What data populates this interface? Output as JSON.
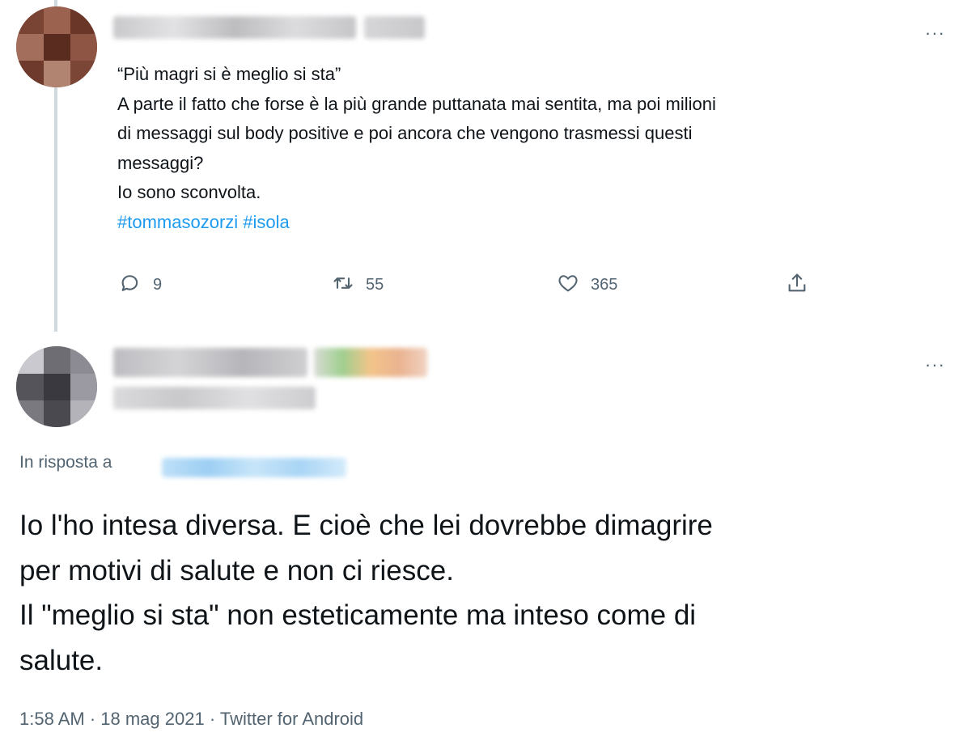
{
  "tweet1": {
    "more_label": "···",
    "lines": [
      "“Più magri si è meglio si sta”",
      "A parte il fatto che forse è la più grande puttanata mai sentita, ma poi milioni",
      "di messaggi sul body positive e poi ancora che vengono trasmessi questi",
      "messaggi?",
      "Io sono sconvolta."
    ],
    "hashtags": [
      "#tommasozorzi",
      "#isola"
    ],
    "stats": {
      "replies": "9",
      "retweets": "55",
      "likes": "365"
    }
  },
  "tweet2": {
    "more_label": "···",
    "reply_prefix": "In risposta a",
    "lines": [
      "Io l'ho intesa diversa. E cioè che lei dovrebbe dimagrire",
      "per motivi di salute e non ci riesce.",
      "Il \"meglio si sta\" non esteticamente ma inteso come di",
      "salute."
    ],
    "meta": "1:58 AM · 18 mag 2021 · Twitter for Android"
  },
  "icons": {
    "reply": "speech-bubble-icon",
    "retweet": "retweet-icon",
    "like": "heart-icon",
    "share": "share-upload-icon",
    "more": "ellipsis-icon"
  },
  "colors": {
    "text": "#0f1419",
    "secondary": "#536471",
    "link": "#1d9bf0",
    "thread": "#cfd9de"
  }
}
